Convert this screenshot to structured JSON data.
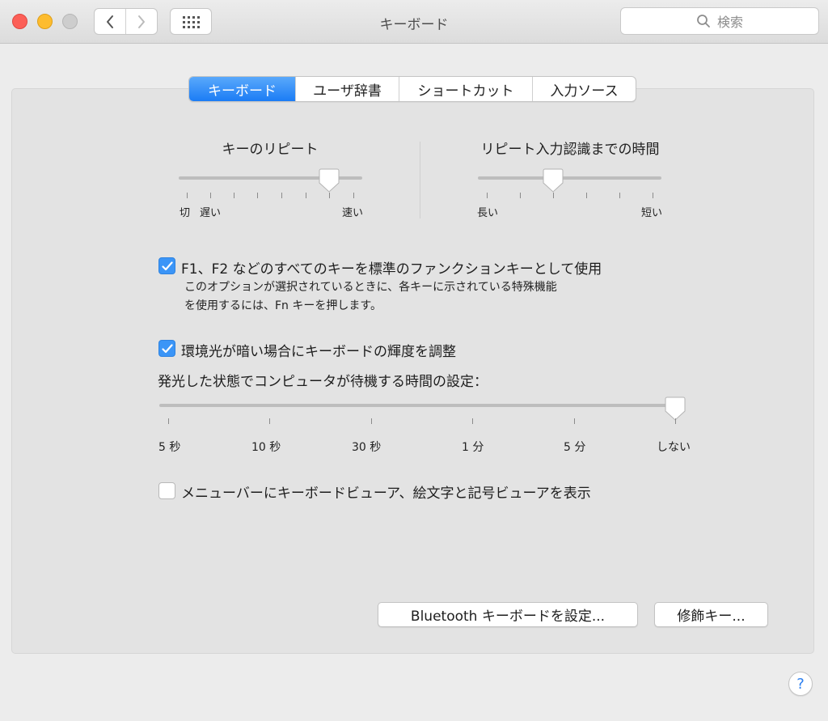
{
  "window": {
    "title": "キーボード"
  },
  "toolbar": {
    "search_placeholder": "検索"
  },
  "tabs": [
    {
      "label": "キーボード",
      "active": true
    },
    {
      "label": "ユーザ辞書",
      "active": false
    },
    {
      "label": "ショートカット",
      "active": false
    },
    {
      "label": "入力ソース",
      "active": false
    }
  ],
  "key_repeat": {
    "title": "キーのリピート",
    "label_off": "切",
    "label_slow": "遅い",
    "label_fast": "速い",
    "value_fraction": 0.83
  },
  "repeat_delay": {
    "title": "リピート入力認識までの時間",
    "label_long": "長い",
    "label_short": "短い",
    "value_fraction": 0.4
  },
  "fn_keys": {
    "checked": true,
    "label": "F1、F2 などのすべてのキーを標準のファンクションキーとして使用",
    "desc_line1": "このオプションが選択されているときに、各キーに示されている特殊機能",
    "desc_line2": "を使用するには、Fn キーを押します。"
  },
  "backlight": {
    "checked": true,
    "label": "環境光が暗い場合にキーボードの輝度を調整"
  },
  "idle": {
    "title": "発光した状態でコンピュータが待機する時間の設定：",
    "labels": [
      "5 秒",
      "10 秒",
      "30 秒",
      "1 分",
      "5 分",
      "しない"
    ],
    "selected": "しない"
  },
  "menubar_viewer": {
    "checked": false,
    "label": "メニューバーにキーボードビューア、絵文字と記号ビューアを表示"
  },
  "buttons": {
    "bluetooth": "Bluetooth キーボードを設定...",
    "modifier": "修飾キー..."
  },
  "help": "?",
  "colors": {
    "accent": "#3b95f7",
    "close": "#fc5f57",
    "minimize": "#fdbc2e"
  }
}
